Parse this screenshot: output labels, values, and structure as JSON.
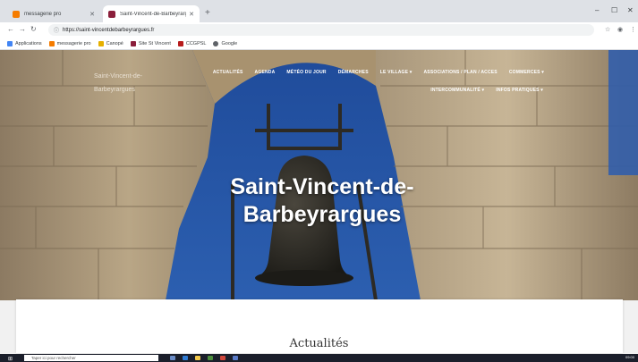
{
  "browser": {
    "tabs": [
      {
        "label": "messagerie pro",
        "favicon_color": "#f57c00",
        "active": false
      },
      {
        "label": "Saint-Vincent-de-Barbeyrargues",
        "favicon_color": "#8b1f3b",
        "active": true
      }
    ],
    "new_tab_icon": "plus-icon",
    "window_controls": {
      "minimize": "–",
      "maximize": "☐",
      "close": "✕"
    },
    "url": "https://saint-vincentdebarbeyrargues.fr",
    "bookmarks": [
      {
        "label": "Applications",
        "color": "#4285f4"
      },
      {
        "label": "messagerie pro",
        "color": "#f57c00"
      },
      {
        "label": "Canopé",
        "color": "#e6b000"
      },
      {
        "label": "Site St Vincent",
        "color": "#8b1f3b"
      },
      {
        "label": "CCGPSL",
        "color": "#b71c1c"
      },
      {
        "label": "Google",
        "color": "#5f6368"
      }
    ]
  },
  "site": {
    "logo_text": "Saint-Vincent-de-Barbeyrargues",
    "nav_row1": [
      "ACTUALITÉS",
      "AGENDA",
      "MÉTÉO DU JOUR",
      "DÉMARCHES",
      "LE VILLAGE ▾",
      "ASSOCIATIONS / PLAN / ACCES",
      "COMMERCES ▾"
    ],
    "nav_row2": [
      "INTERCOMMUNALITÉ ▾",
      "INFOS PRATIQUES ▾"
    ],
    "hero_title_line1": "Saint-Vincent-de-",
    "hero_title_line2": "Barbeyrargues",
    "section_title": "Actualités"
  },
  "taskbar": {
    "search_placeholder": "Taper ici pour rechercher",
    "clock": "09:00"
  },
  "colors": {
    "sky": "#24519e",
    "stone": "#b7a58a",
    "bell": "#2a2823"
  }
}
